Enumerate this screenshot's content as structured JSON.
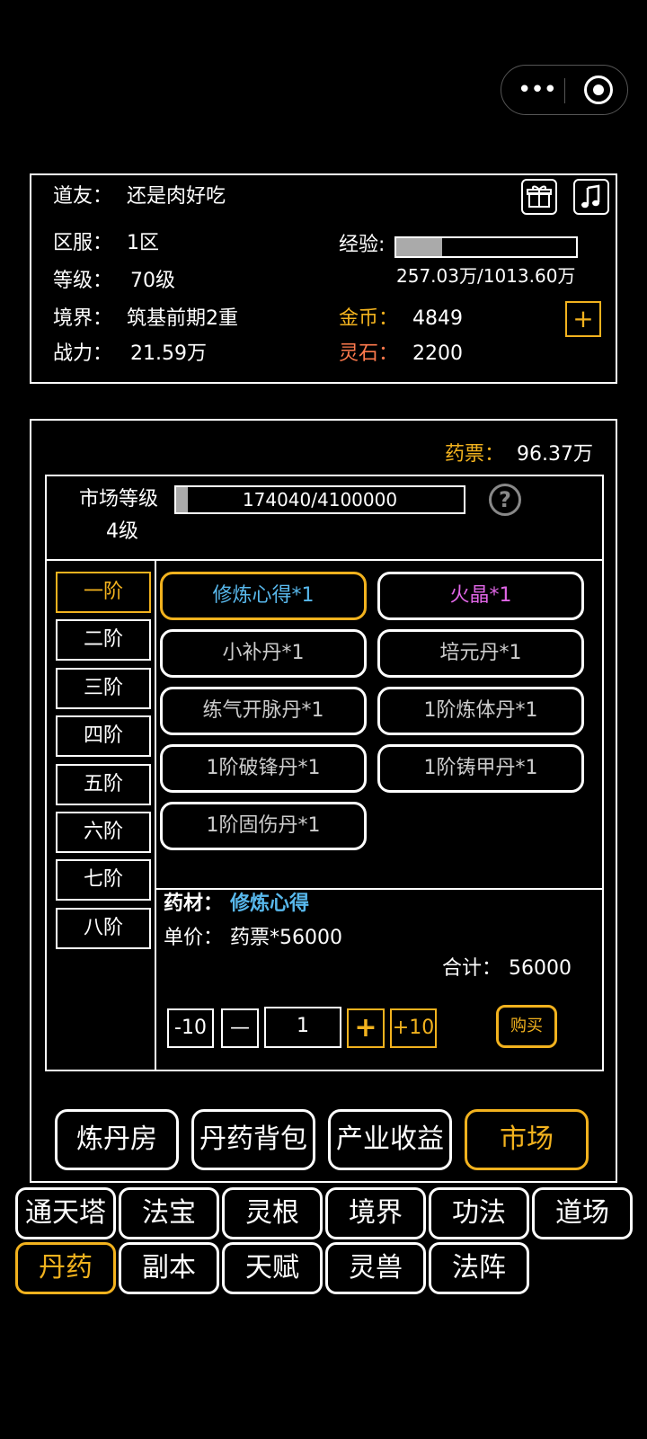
{
  "profile": {
    "name_label": "道友：",
    "name_value": "还是肉好吃",
    "server_label": "区服：",
    "server_value": "1区",
    "level_label": "等级：",
    "level_value": "70级",
    "realm_label": "境界：",
    "realm_value": "筑基前期2重",
    "power_label": "战力：",
    "power_value": "21.59万",
    "exp_label": "经验:",
    "exp_text": "257.03万/1013.60万",
    "exp_progress": 0.254,
    "gold_label": "金币：",
    "gold_value": "4849",
    "stone_label": "灵石：",
    "stone_value": "2200",
    "add_symbol": "+"
  },
  "market": {
    "ticket_label": "药票：",
    "ticket_value": "96.37万",
    "level_label": "市场等级",
    "level_value": "4级",
    "level_progress_text": "174040/4100000",
    "level_progress": 0.042,
    "help_symbol": "?",
    "tiers": [
      "一阶",
      "二阶",
      "三阶",
      "四阶",
      "五阶",
      "六阶",
      "七阶",
      "八阶"
    ],
    "selected_tier": 0,
    "items": [
      "修炼心得*1",
      "火晶*1",
      "小补丹*1",
      "培元丹*1",
      "练气开脉丹*1",
      "1阶炼体丹*1",
      "1阶破锋丹*1",
      "1阶铸甲丹*1",
      "1阶固伤丹*1"
    ],
    "detail": {
      "material_label": "药材：",
      "material_value": "修炼心得",
      "price_label": "单价：",
      "price_value": "药票*56000",
      "total_label": "合计：",
      "total_value": "56000"
    },
    "qty": {
      "minus10": "-10",
      "minus": "—",
      "value": "1",
      "plus": "+",
      "plus10": "+10",
      "buy": "购买"
    }
  },
  "section_nav": [
    "炼丹房",
    "丹药背包",
    "产业收益",
    "市场"
  ],
  "system_nav_row1": [
    "通天塔",
    "法宝",
    "灵根",
    "境界",
    "功法",
    "道场"
  ],
  "system_nav_row2": [
    "丹药",
    "副本",
    "天赋",
    "灵兽",
    "法阵"
  ],
  "colors": {
    "accent": "#f2b21e",
    "gold": "#f2b21e",
    "stone": "#ff7a4d",
    "material": "#58b8ec",
    "rare": "#e066e6"
  }
}
